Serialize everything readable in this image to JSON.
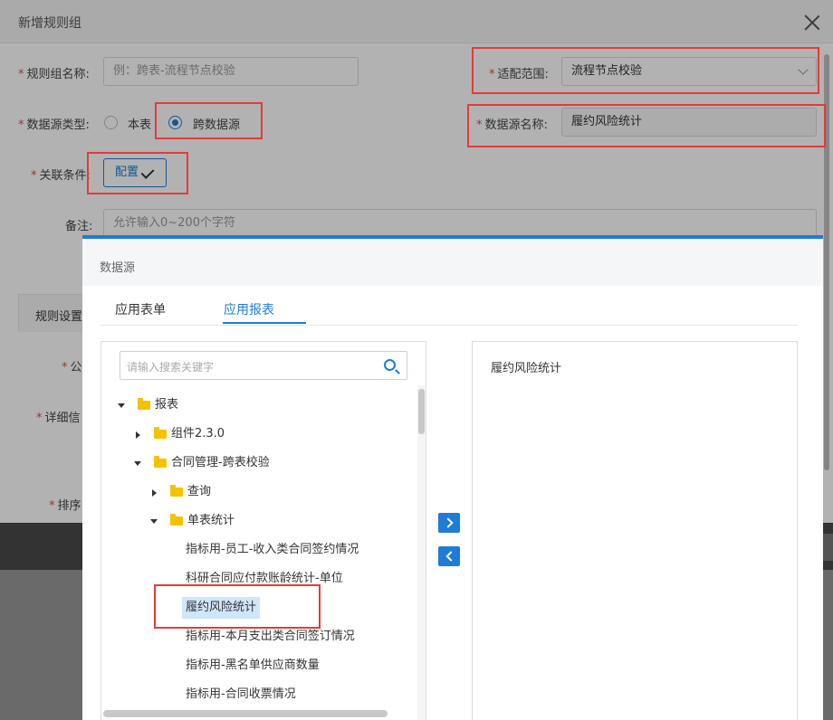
{
  "base": {
    "title": "新增规则组",
    "required_mark": "*",
    "rule_group_name_label": "规则组名称:",
    "rule_group_name_placeholder": "例：跨表-流程节点校验",
    "scope_label": "适配范围:",
    "scope_value": "流程节点校验",
    "source_type_label": "数据源类型:",
    "source_type_options": [
      "本表",
      "跨数据源"
    ],
    "source_type_selected": "跨数据源",
    "source_name_label": "数据源名称:",
    "source_name_value": "履约风险统计",
    "relation_label": "关联条件:",
    "config_button": "配置",
    "remark_label": "备注:",
    "remark_placeholder": "允许输入0~200个字符",
    "rule_settings_tab": "规则设置",
    "partial_labels": [
      "公",
      "详细信",
      "排序"
    ]
  },
  "modal": {
    "title": "数据源",
    "tabs": [
      {
        "label": "应用表单"
      },
      {
        "label": "应用报表"
      }
    ],
    "active_tab": "应用报表",
    "search_placeholder": "请输入搜索关键字",
    "tree": [
      {
        "label": "报表",
        "type": "folder",
        "expanded": true,
        "level": 0
      },
      {
        "label": "组件2.3.0",
        "type": "folder",
        "expanded": false,
        "level": 1
      },
      {
        "label": "合同管理-跨表校验",
        "type": "folder",
        "expanded": true,
        "level": 1
      },
      {
        "label": "查询",
        "type": "folder",
        "expanded": false,
        "level": 2
      },
      {
        "label": "单表统计",
        "type": "folder",
        "expanded": true,
        "level": 2
      },
      {
        "label": "指标用-员工-收入类合同签约情况",
        "type": "leaf",
        "level": 3
      },
      {
        "label": "科研合同应付款账龄统计-单位",
        "type": "leaf",
        "level": 3
      },
      {
        "label": "履约风险统计",
        "type": "leaf",
        "level": 3,
        "selected": true
      },
      {
        "label": "指标用-本月支出类合同签订情况",
        "type": "leaf",
        "level": 3
      },
      {
        "label": "指标用-黑名单供应商数量",
        "type": "leaf",
        "level": 3
      },
      {
        "label": "指标用-合同收票情况",
        "type": "leaf",
        "level": 3
      }
    ],
    "selected_items": [
      "履约风险统计"
    ]
  },
  "colors": {
    "accent": "#1e7bd6",
    "highlight_box": "#e33b3b",
    "folder": "#f5c200",
    "required": "#e14b4b"
  }
}
